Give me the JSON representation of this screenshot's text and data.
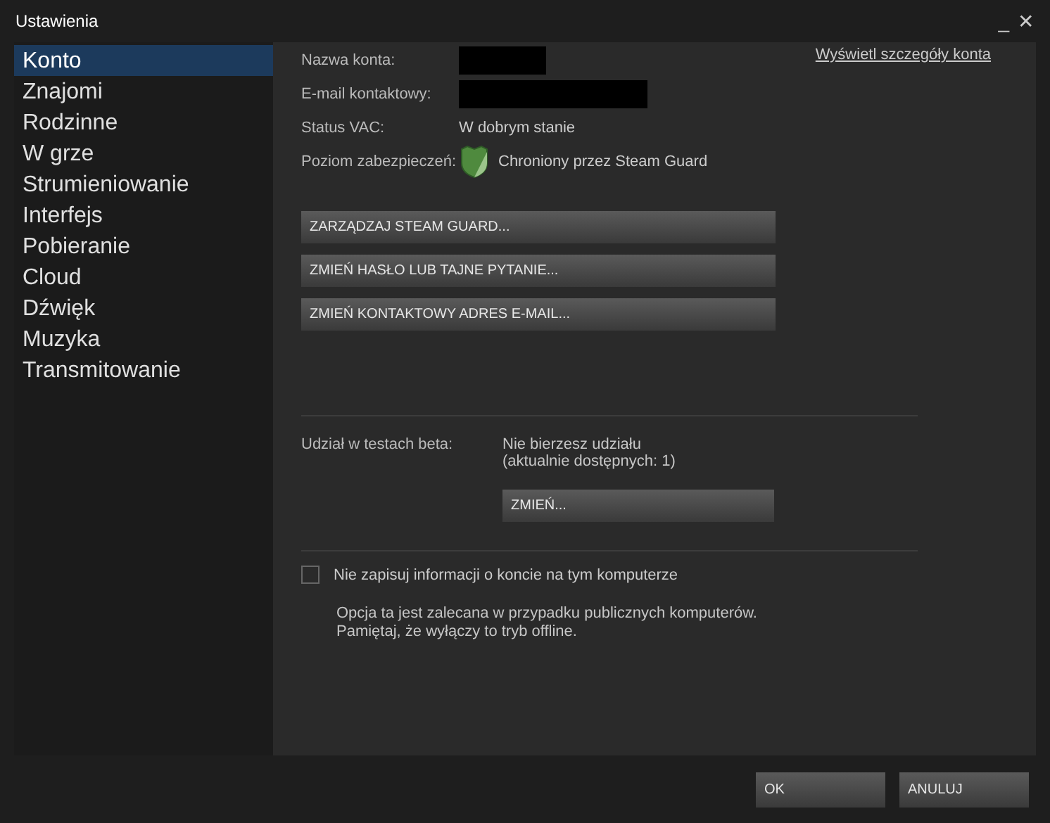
{
  "window": {
    "title": "Ustawienia",
    "controls": [
      "_",
      "✕"
    ]
  },
  "sidebar": {
    "items": [
      {
        "label": "Konto",
        "selected": true
      },
      {
        "label": "Znajomi",
        "selected": false
      },
      {
        "label": "Rodzinne",
        "selected": false
      },
      {
        "label": "W grze",
        "selected": false
      },
      {
        "label": "Strumieniowanie",
        "selected": false
      },
      {
        "label": "Interfejs",
        "selected": false
      },
      {
        "label": "Pobieranie",
        "selected": false
      },
      {
        "label": "Cloud",
        "selected": false
      },
      {
        "label": "Dźwięk",
        "selected": false
      },
      {
        "label": "Muzyka",
        "selected": false
      },
      {
        "label": "Transmitowanie",
        "selected": false
      }
    ]
  },
  "account": {
    "details_link": "Wyświetl szczegóły konta",
    "fields": [
      {
        "label": "Nazwa konta:",
        "kind": "redacted"
      },
      {
        "label": "E-mail kontaktowy:",
        "kind": "redacted"
      },
      {
        "label": "Status VAC:",
        "kind": "text",
        "value": "W dobrym stanie"
      },
      {
        "label": "Poziom zabezpieczeń:",
        "kind": "shield",
        "value": "Chroniony przez Steam Guard"
      }
    ],
    "buttons": [
      "ZARZĄDZAJ STEAM GUARD...",
      "ZMIEŃ HASŁO LUB TAJNE PYTANIE...",
      "ZMIEŃ KONTAKTOWY ADRES E-MAIL..."
    ]
  },
  "beta": {
    "label": "Udział w testach beta:",
    "status": "Nie bierzesz udziału",
    "available": "(aktualnie dostępnych: 1)",
    "button": "ZMIEŃ..."
  },
  "remember": {
    "label": "Nie zapisuj informacji o koncie na tym komputerze",
    "checked": false,
    "note": [
      "Opcja ta jest zalecana w przypadku publicznych komputerów.",
      "Pamiętaj, że wyłączy to tryb offline."
    ]
  },
  "footer": {
    "buttons": [
      "OK",
      "ANULUJ"
    ]
  }
}
